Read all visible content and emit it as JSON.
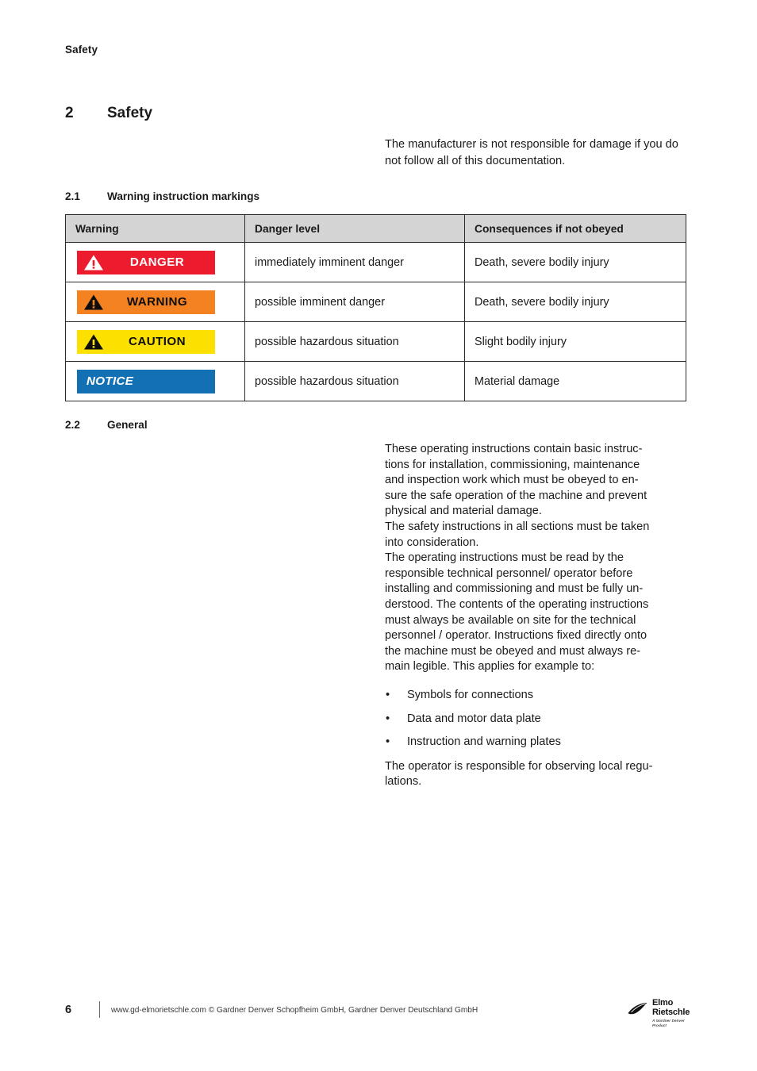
{
  "running_header": "Safety",
  "chapter": {
    "number": "2",
    "title": "Safety"
  },
  "intro_paragraph": "The manufacturer is not responsible for damage if you do not follow all of this documentation.",
  "sections": {
    "warning_markings": {
      "number": "2.1",
      "title": "Warning instruction markings"
    },
    "general": {
      "number": "2.2",
      "title": "General"
    }
  },
  "warning_table": {
    "headers": [
      "Warning",
      "Danger level",
      "Consequences if not obeyed"
    ],
    "rows": [
      {
        "signal_word": "DANGER",
        "badge_style": "danger",
        "badge_bg": "#ec1c2e",
        "badge_fg": "#ffffff",
        "has_triangle": true,
        "danger_level": "immediately imminent danger",
        "consequences": "Death, severe bodily injury"
      },
      {
        "signal_word": "WARNING",
        "badge_style": "warning",
        "badge_bg": "#f58220",
        "badge_fg": "#0d0d0d",
        "has_triangle": true,
        "danger_level": "possible imminent danger",
        "consequences": "Death, severe bodily injury"
      },
      {
        "signal_word": "CAUTION",
        "badge_style": "caution",
        "badge_bg": "#fbe000",
        "badge_fg": "#0d0d0d",
        "has_triangle": true,
        "danger_level": "possible hazardous situation",
        "consequences": "Slight bodily injury"
      },
      {
        "signal_word": "NOTICE",
        "badge_style": "notice",
        "badge_bg": "#1270b3",
        "badge_fg": "#ffffff",
        "has_triangle": false,
        "danger_level": "possible hazardous situation",
        "consequences": "Material damage"
      }
    ]
  },
  "general_body": {
    "paragraph_1": "These operating instructions contain basic instruc-\ntions for installation, commissioning, maintenance\nand inspection work which must be obeyed to en-\nsure the safe operation of the machine and prevent\nphysical and material damage.\nThe safety instructions in all sections must be taken\ninto consideration.\nThe operating instructions must be read by the\nresponsible technical personnel/ operator before\ninstalling and commissioning and must be fully un-\nderstood. The contents of the operating instructions\nmust always be available on site for the technical\npersonnel / operator. Instructions fixed directly onto\nthe machine must be obeyed and must always re-\nmain legible. This applies for example to:",
    "bullets": [
      "Symbols for connections",
      "Data and motor data plate",
      "Instruction and warning plates"
    ],
    "bullet_glyph": "•",
    "paragraph_2": "The operator is responsible for observing local regu-\nlations."
  },
  "footer": {
    "page_number": "6",
    "text": "www.gd-elmorietschle.com © Gardner Denver Schopfheim GmbH, Gardner Denver Deutschland GmbH"
  },
  "logo": {
    "line1": "Elmo",
    "line2": "Rietschle",
    "tagline": "A Gardner Denver Product"
  }
}
